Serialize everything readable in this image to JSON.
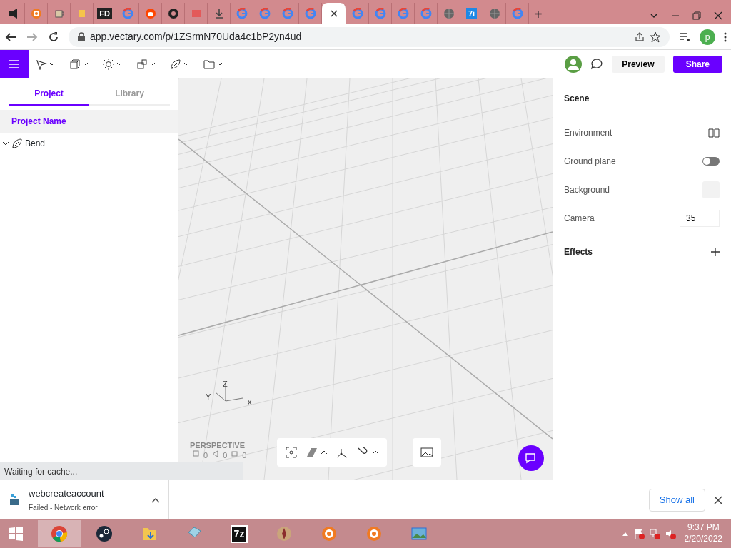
{
  "browser": {
    "tabs": [
      {
        "kind": "speaker",
        "selected": false
      },
      {
        "kind": "orange-circle",
        "selected": false
      },
      {
        "kind": "cup",
        "selected": false
      },
      {
        "kind": "note",
        "selected": false
      },
      {
        "kind": "text",
        "text": "FD",
        "selected": false
      },
      {
        "kind": "google",
        "selected": false
      },
      {
        "kind": "reddit",
        "selected": false
      },
      {
        "kind": "github",
        "selected": false
      },
      {
        "kind": "red-square",
        "selected": false
      },
      {
        "kind": "download",
        "selected": false
      },
      {
        "kind": "google",
        "selected": false
      },
      {
        "kind": "google",
        "selected": false
      },
      {
        "kind": "google",
        "selected": false
      },
      {
        "kind": "google",
        "selected": false
      },
      {
        "kind": "close",
        "selected": true
      },
      {
        "kind": "google",
        "selected": false
      },
      {
        "kind": "google",
        "selected": false
      },
      {
        "kind": "google",
        "selected": false
      },
      {
        "kind": "google",
        "selected": false
      },
      {
        "kind": "globe",
        "selected": false
      },
      {
        "kind": "text",
        "text": "7i",
        "selected": false
      },
      {
        "kind": "globe",
        "selected": false
      },
      {
        "kind": "google",
        "selected": false
      }
    ],
    "new_tab": "+",
    "url": "app.vectary.com/p/1ZSrmN70Uda4c1bP2yn4ud",
    "profile": "p"
  },
  "toolbar": {
    "tools": [
      {
        "kind": "pointer"
      },
      {
        "kind": "cube"
      },
      {
        "kind": "sun"
      },
      {
        "kind": "shapes"
      },
      {
        "kind": "leaf"
      },
      {
        "kind": "folder"
      }
    ],
    "preview": "Preview",
    "share": "Share"
  },
  "left_panel": {
    "tabs": [
      {
        "label": "Project",
        "selected": true
      },
      {
        "label": "Library",
        "selected": false
      }
    ],
    "project_name": "Project Name",
    "tree": [
      {
        "label": "Bend",
        "expanded": true
      }
    ]
  },
  "viewport": {
    "axes": {
      "z": "Z",
      "y": "Y",
      "x": "X"
    },
    "view": "PERSPECTIVE",
    "counts": [
      "0",
      "0",
      "0"
    ],
    "status": "Waiting for cache..."
  },
  "right_panel": {
    "title": "Scene",
    "rows": [
      {
        "kind": "book",
        "label": "Environment"
      },
      {
        "kind": "toggle",
        "label": "Ground plane",
        "on": false
      },
      {
        "kind": "swatch",
        "label": "Background"
      },
      {
        "kind": "number",
        "label": "Camera",
        "value": "35"
      }
    ],
    "effects": "Effects"
  },
  "download": {
    "file": "webcreateaccount",
    "status": "Failed - Network error",
    "show_all": "Show all"
  },
  "taskbar": {
    "apps": [
      {
        "kind": "chrome",
        "selected": true
      },
      {
        "kind": "steam",
        "selected": false
      },
      {
        "kind": "folder",
        "selected": false
      },
      {
        "kind": "notepad",
        "selected": false
      },
      {
        "kind": "text",
        "text": "7z",
        "selected": false
      },
      {
        "kind": "compass",
        "selected": false
      },
      {
        "kind": "orange-circle",
        "selected": false
      },
      {
        "kind": "orange-circle",
        "selected": false
      },
      {
        "kind": "picture",
        "selected": false
      }
    ],
    "time": "9:37 PM",
    "date": "2/20/2022"
  }
}
